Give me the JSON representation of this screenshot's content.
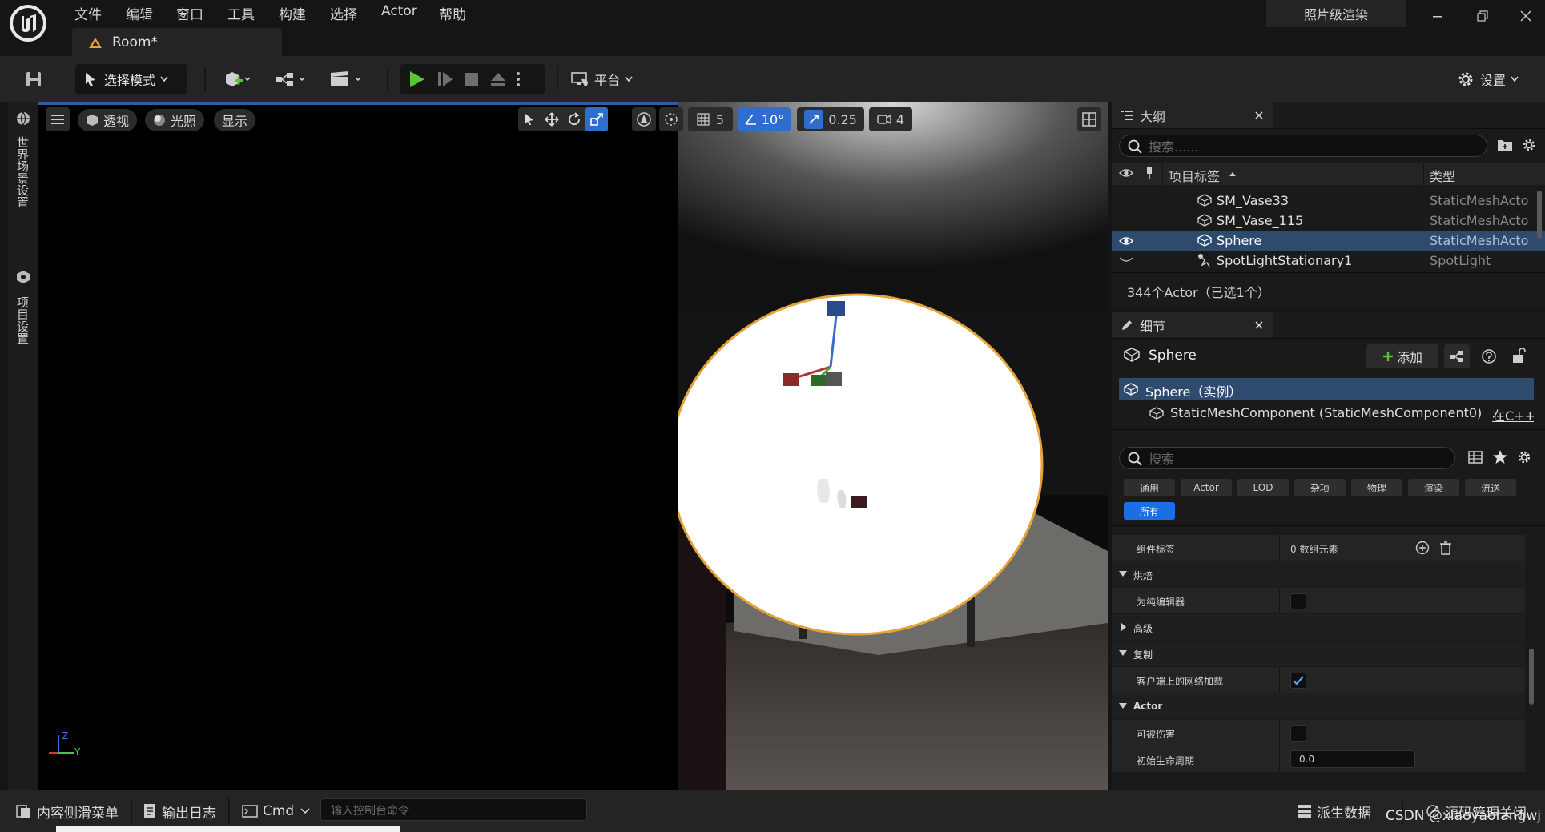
{
  "app": {
    "logo": "unreal-logo"
  },
  "menu": [
    "文件",
    "编辑",
    "窗口",
    "工具",
    "构建",
    "选择",
    "Actor",
    "帮助"
  ],
  "title_right": {
    "render_label": "照片级渲染"
  },
  "tab": {
    "label": "Room*"
  },
  "toolbar": {
    "select_mode": "选择模式",
    "platform": "平台",
    "settings": "设置"
  },
  "left_rail": {
    "world_settings": "世界场景设置",
    "project_settings": "项目设置"
  },
  "viewport": {
    "perspective": "透视",
    "lighting": "光照",
    "show": "显示",
    "grid_value": "5",
    "angle_value": "10°",
    "scale_value": "0.25",
    "camera_speed": "4",
    "axis_z": "Z",
    "axis_y": "Y"
  },
  "outliner": {
    "tab_label": "大纲",
    "search_placeholder": "搜索......",
    "col_label": "项目标签",
    "col_type": "类型",
    "rows": [
      {
        "name": "SM_Vase33",
        "type": "StaticMeshActo"
      },
      {
        "name": "SM_Vase_115",
        "type": "StaticMeshActo"
      },
      {
        "name": "Sphere",
        "type": "StaticMeshActo"
      },
      {
        "name": "SpotLightStationary1",
        "type": "SpotLight"
      }
    ],
    "count": "344个Actor（已选1个）"
  },
  "details": {
    "tab_label": "细节",
    "actor_name": "Sphere",
    "add_label": "添加",
    "instance": "Sphere（实例）",
    "component": "StaticMeshComponent (StaticMeshComponent0)",
    "component_link": "在C++中",
    "search_placeholder": "搜索",
    "categories": [
      "通用",
      "Actor",
      "LOD",
      "杂项",
      "物理",
      "渲染",
      "流送",
      "所有"
    ],
    "props": {
      "component_tags": "组件标签",
      "array_value": "0 数组元素",
      "bake": "烘焙",
      "editor_only": "为纯编辑器",
      "advanced": "高级",
      "replication": "复制",
      "net_load": "客户端上的网络加载",
      "actor": "Actor",
      "can_damage": "可被伤害",
      "lifespan": "初始生命周期",
      "lifespan_value": "0.0"
    }
  },
  "bottombar": {
    "content_drawer": "内容侧滑菜单",
    "output_log": "输出日志",
    "cmd": "Cmd",
    "console_placeholder": "输入控制台命令",
    "derived_data": "派生数据",
    "source_control": "源码管理关闭",
    "watermark": "CSDN @xiaoyaofangwj"
  },
  "colors": {
    "accent_blue": "#2f5e9a",
    "play_green": "#5ec23a",
    "selection_orange": "#e6a33a"
  }
}
